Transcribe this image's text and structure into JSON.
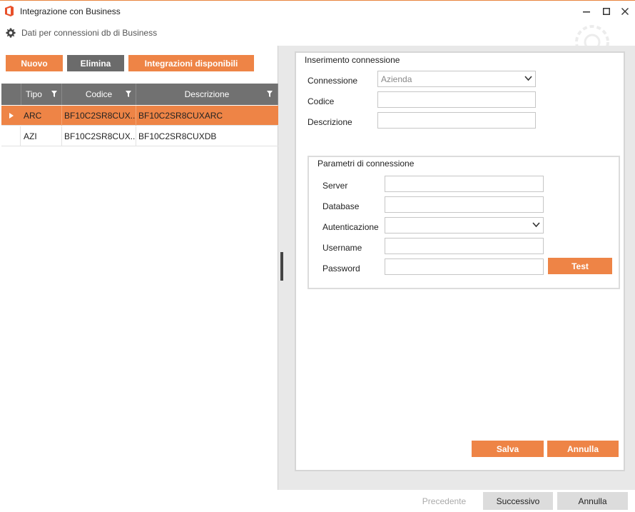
{
  "window": {
    "title": "Integrazione con Business",
    "minimize_icon": "minimize-icon",
    "maximize_icon": "maximize-icon",
    "close_icon": "close-icon",
    "accent": "#ee8446"
  },
  "header": {
    "subtitle": "Dati per connessioni db di Business",
    "icon": "gear-icon"
  },
  "toolbar": {
    "new_label": "Nuovo",
    "delete_label": "Elimina",
    "available_label": "Integrazioni disponibili"
  },
  "grid": {
    "columns": [
      "Tipo",
      "Codice",
      "Descrizione"
    ],
    "rows": [
      {
        "tipo": "ARC",
        "codice": "BF10C2SR8CUX...",
        "descrizione": "BF10C2SR8CUXARC",
        "selected": true
      },
      {
        "tipo": "AZI",
        "codice": "BF10C2SR8CUX...",
        "descrizione": "BF10C2SR8CUXDB",
        "selected": false
      }
    ]
  },
  "connection_form": {
    "group_title": "Inserimento connessione",
    "connessione_label": "Connessione",
    "connessione_value": "Azienda",
    "codice_label": "Codice",
    "codice_value": "",
    "descrizione_label": "Descrizione",
    "descrizione_value": ""
  },
  "params": {
    "group_title": "Parametri di connessione",
    "server_label": "Server",
    "database_label": "Database",
    "auth_label": "Autenticazione",
    "username_label": "Username",
    "password_label": "Password",
    "server_value": "",
    "database_value": "",
    "auth_value": "",
    "username_value": "",
    "password_value": "",
    "test_label": "Test"
  },
  "form_actions": {
    "save_label": "Salva",
    "cancel_label": "Annulla"
  },
  "footer": {
    "previous_label": "Precedente",
    "next_label": "Successivo",
    "cancel_label": "Annulla"
  }
}
